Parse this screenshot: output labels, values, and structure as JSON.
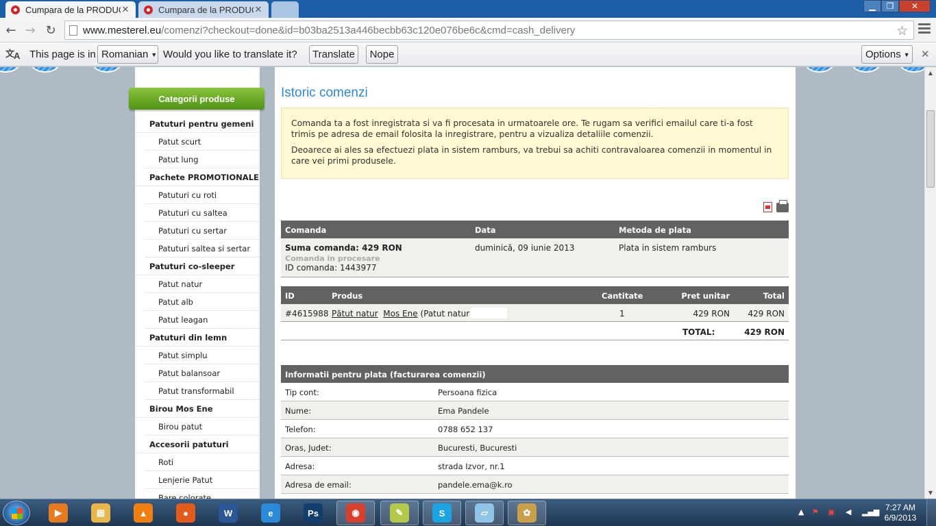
{
  "tabs": [
    {
      "label": "Cumpara de la PRODUCATOR",
      "active": true
    },
    {
      "label": "Cumpara de la PRODUCATOR",
      "active": false
    }
  ],
  "omnibox": {
    "host": "www.mesterel.eu",
    "path": "/comenzi?checkout=done&id=b03ba2513a446becbb63c120e076be6c&cmd=cash_delivery"
  },
  "translate_bar": {
    "prefix": "This page is in",
    "language": "Romanian",
    "question": "Would you like to translate it?",
    "translate_label": "Translate",
    "nope_label": "Nope",
    "options_label": "Options"
  },
  "sidebar": {
    "header": "Categorii produse",
    "items": [
      {
        "label": "Patuturi pentru gemeni",
        "group": true
      },
      {
        "label": "Patut scurt",
        "group": false
      },
      {
        "label": "Patut lung",
        "group": false
      },
      {
        "label": "Pachete PROMOTIONALE",
        "group": true
      },
      {
        "label": "Patuturi cu roti",
        "group": false
      },
      {
        "label": "Patuturi cu saltea",
        "group": false
      },
      {
        "label": "Patuturi cu sertar",
        "group": false
      },
      {
        "label": "Patuturi saltea si sertar",
        "group": false
      },
      {
        "label": "Patuturi co-sleeper",
        "group": true
      },
      {
        "label": "Patut natur",
        "group": false
      },
      {
        "label": "Patut alb",
        "group": false
      },
      {
        "label": "Patut leagan",
        "group": false
      },
      {
        "label": "Patuturi din lemn",
        "group": true
      },
      {
        "label": "Patut simplu",
        "group": false
      },
      {
        "label": "Patut balansoar",
        "group": false
      },
      {
        "label": "Patut transformabil",
        "group": false
      },
      {
        "label": "Birou Mos Ene",
        "group": true
      },
      {
        "label": "Birou patut",
        "group": false
      },
      {
        "label": "Accesorii patuturi",
        "group": true
      },
      {
        "label": "Roti",
        "group": false
      },
      {
        "label": "Lenjerie Patut",
        "group": false
      },
      {
        "label": "Bare colorate",
        "group": false
      }
    ]
  },
  "main": {
    "title": "Istoric comenzi",
    "notice": [
      "Comanda ta a fost inregistrata si va fi procesata in urmatoarele ore. Te rugam sa verifici emailul care ti-a fost trimis pe adresa de email folosita la inregistrare, pentru a vizualiza detaliile comenzii.",
      "Deoarece ai ales sa efectuezi plata in sistem ramburs, va trebui sa achiti contravaloarea comenzii in momentul in care vei primi produsele."
    ],
    "order_table": {
      "headers": [
        "Comanda",
        "Data",
        "Metoda de plata"
      ],
      "sum": "Suma comanda: 429 RON",
      "status": "Comanda in procesare",
      "order_id": "ID comanda: 1443977",
      "date": "duminică, 09 iunie 2013",
      "payment": "Plata in sistem ramburs"
    },
    "product_table": {
      "headers": [
        "ID",
        "Produs",
        "Cantitate",
        "Pret unitar",
        "Total"
      ],
      "row": {
        "id": "#4615988",
        "link1": "Pătut natur",
        "link2": "Mos Ene",
        "suffix": "(Patut natur)",
        "qty": "1",
        "unit": "429 RON",
        "total": "429 RON"
      },
      "total_label": "TOTAL:",
      "total_value": "429 RON"
    },
    "billing": {
      "header": "Informatii pentru plata (facturarea comenzii)",
      "rows": [
        {
          "label": "Tip cont:",
          "value": "Persoana fizica"
        },
        {
          "label": "Nume:",
          "value": "Ema Pandele"
        },
        {
          "label": "Telefon:",
          "value": "0788 652 137"
        },
        {
          "label": "Oras, Judet:",
          "value": "Bucuresti, Bucuresti"
        },
        {
          "label": "Adresa:",
          "value": "strada Izvor, nr.1"
        },
        {
          "label": "Adresa de email:",
          "value": "pandele.ema@k.ro"
        }
      ]
    }
  },
  "taskbar": {
    "time": "7:27 AM",
    "date": "6/9/2013",
    "apps": [
      {
        "name": "media-player-icon",
        "color": "#e57a1f",
        "glyph": "▶",
        "open": false
      },
      {
        "name": "file-explorer-icon",
        "color": "#e8b64a",
        "glyph": "▤",
        "open": false
      },
      {
        "name": "vlc-icon",
        "color": "#f07f12",
        "glyph": "▲",
        "open": false
      },
      {
        "name": "firefox-icon",
        "color": "#e25b1c",
        "glyph": "●",
        "open": false
      },
      {
        "name": "word-icon",
        "color": "#2b5797",
        "glyph": "W",
        "open": false
      },
      {
        "name": "internet-explorer-icon",
        "color": "#2a8ad8",
        "glyph": "e",
        "open": false
      },
      {
        "name": "photoshop-icon",
        "color": "#123e6d",
        "glyph": "Ps",
        "open": false
      },
      {
        "name": "chrome-icon",
        "color": "#d8402e",
        "glyph": "◉",
        "open": true
      },
      {
        "name": "notes-icon",
        "color": "#b4c94a",
        "glyph": "✎",
        "open": true
      },
      {
        "name": "skype-icon",
        "color": "#1ba3e2",
        "glyph": "S",
        "open": true
      },
      {
        "name": "sticky-icon",
        "color": "#8fc4e6",
        "glyph": "▱",
        "open": true
      },
      {
        "name": "paint-icon",
        "color": "#c9a04a",
        "glyph": "✿",
        "open": true
      }
    ]
  }
}
